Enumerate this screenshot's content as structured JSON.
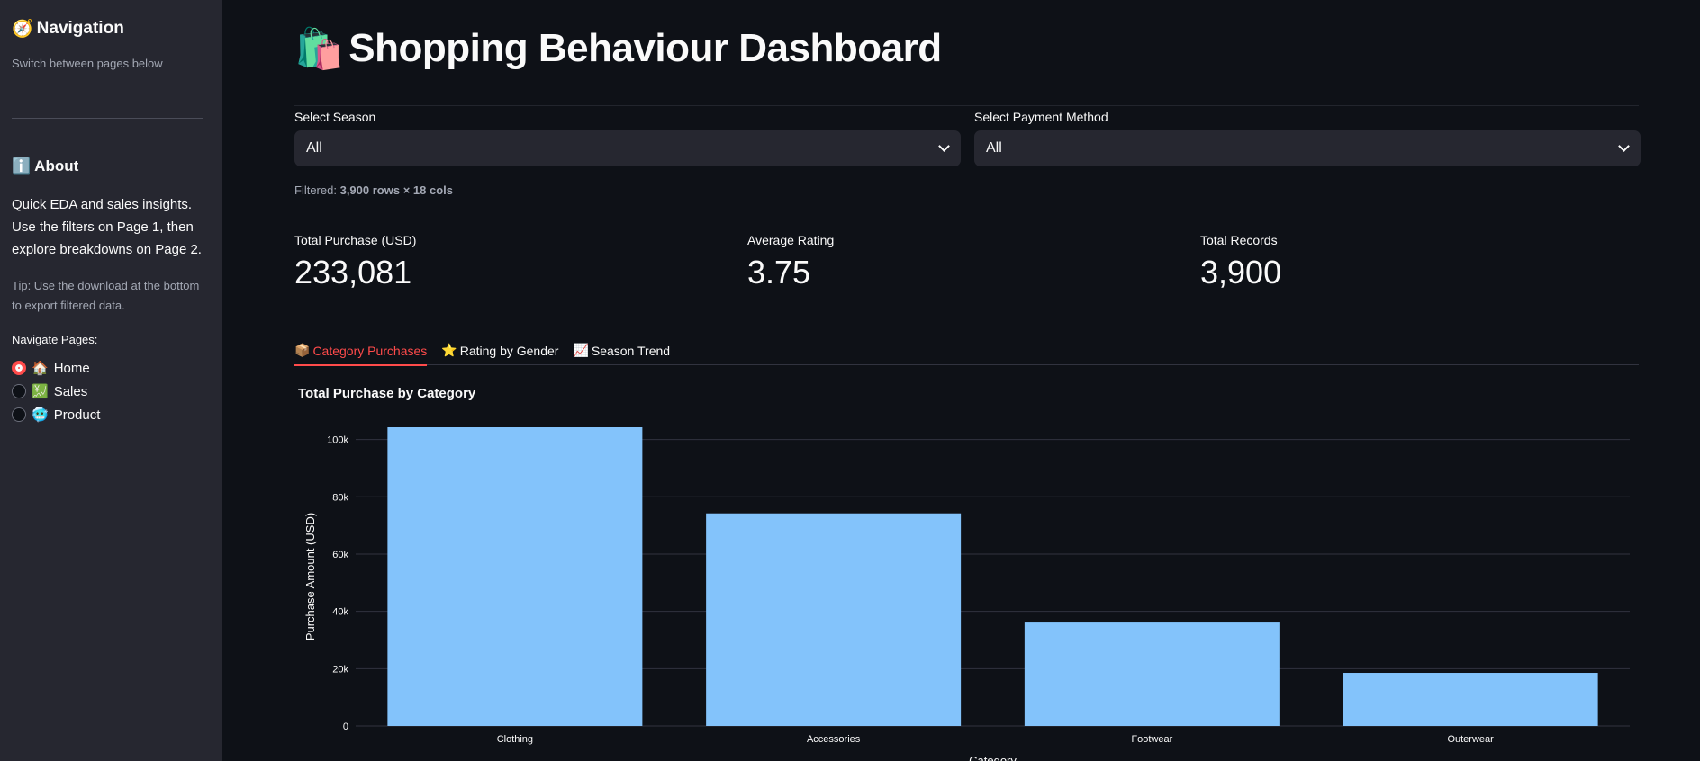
{
  "sidebar": {
    "title_icon": "🧭",
    "title": "Navigation",
    "subtitle": "Switch between pages below",
    "about_icon": "ℹ️",
    "about_title": "About",
    "about_text": "Quick EDA and sales insights. Use the filters on Page 1, then explore breakdowns on Page 2.",
    "tip": "Tip: Use the download at the bottom to export filtered data.",
    "nav_label": "Navigate Pages:",
    "pages": [
      {
        "icon": "🏠",
        "label": "Home",
        "selected": true
      },
      {
        "icon": "💹",
        "label": "Sales",
        "selected": false
      },
      {
        "icon": "🥶",
        "label": "Product",
        "selected": false
      }
    ]
  },
  "header": {
    "icon": "🛍️",
    "title": "Shopping Behaviour Dashboard"
  },
  "filters": {
    "season": {
      "label": "Select Season",
      "value": "All"
    },
    "payment": {
      "label": "Select Payment Method",
      "value": "All"
    }
  },
  "filtered_prefix": "Filtered:",
  "filtered_value": "3,900 rows × 18 cols",
  "metrics": [
    {
      "label": "Total Purchase (USD)",
      "value": "233,081"
    },
    {
      "label": "Average Rating",
      "value": "3.75"
    },
    {
      "label": "Total Records",
      "value": "3,900"
    }
  ],
  "tabs": [
    {
      "icon": "📦",
      "label": "Category Purchases",
      "active": true
    },
    {
      "icon": "⭐",
      "label": "Rating by Gender",
      "active": false
    },
    {
      "icon": "📈",
      "label": "Season Trend",
      "active": false
    }
  ],
  "colors": {
    "accent": "#ff4b4b",
    "bar": "#83c3fb"
  },
  "chart_data": {
    "type": "bar",
    "title": "Total Purchase by Category",
    "categories": [
      "Clothing",
      "Accessories",
      "Footwear",
      "Outerwear"
    ],
    "values": [
      104264,
      74200,
      36093,
      18524
    ],
    "ylabel": "Purchase Amount (USD)",
    "xlabel": "Category",
    "ylim": [
      0,
      104264
    ],
    "yticks": [
      0,
      20000,
      40000,
      60000,
      80000,
      100000
    ],
    "ytick_labels": [
      "0",
      "20k",
      "40k",
      "60k",
      "80k",
      "100k"
    ],
    "grid": true
  }
}
